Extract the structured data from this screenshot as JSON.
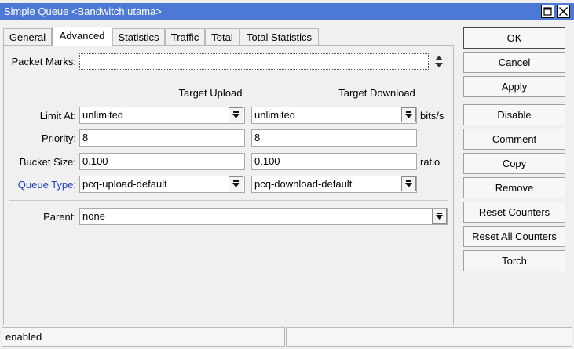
{
  "window": {
    "title": "Simple Queue <Bandwitch utama>"
  },
  "tabs": [
    {
      "label": "General"
    },
    {
      "label": "Advanced"
    },
    {
      "label": "Statistics"
    },
    {
      "label": "Traffic"
    },
    {
      "label": "Total"
    },
    {
      "label": "Total Statistics"
    }
  ],
  "active_tab": "Advanced",
  "form": {
    "packet_marks": {
      "label": "Packet Marks:",
      "value": ""
    },
    "columns": {
      "upload": "Target Upload",
      "download": "Target Download"
    },
    "limit_at": {
      "label": "Limit At:",
      "upload": "unlimited",
      "download": "unlimited",
      "unit": "bits/s"
    },
    "priority": {
      "label": "Priority:",
      "upload": "8",
      "download": "8"
    },
    "bucket_size": {
      "label": "Bucket Size:",
      "upload": "0.100",
      "download": "0.100",
      "unit": "ratio"
    },
    "queue_type": {
      "label": "Queue Type:",
      "upload": "pcq-upload-default",
      "download": "pcq-download-default"
    },
    "parent": {
      "label": "Parent:",
      "value": "none"
    }
  },
  "buttons": {
    "ok": "OK",
    "cancel": "Cancel",
    "apply": "Apply",
    "disable": "Disable",
    "comment": "Comment",
    "copy": "Copy",
    "remove": "Remove",
    "reset_counters": "Reset Counters",
    "reset_all_counters": "Reset All Counters",
    "torch": "Torch"
  },
  "status": {
    "state": "enabled"
  },
  "colors": {
    "titlebar": "#4d79d6",
    "queue_type_label": "#1f3fbf"
  },
  "icons": {
    "restore": "restore-icon",
    "close": "close-icon",
    "dropdown": "dropdown-arrow-icon",
    "updown": "up-down-arrows-icon"
  }
}
